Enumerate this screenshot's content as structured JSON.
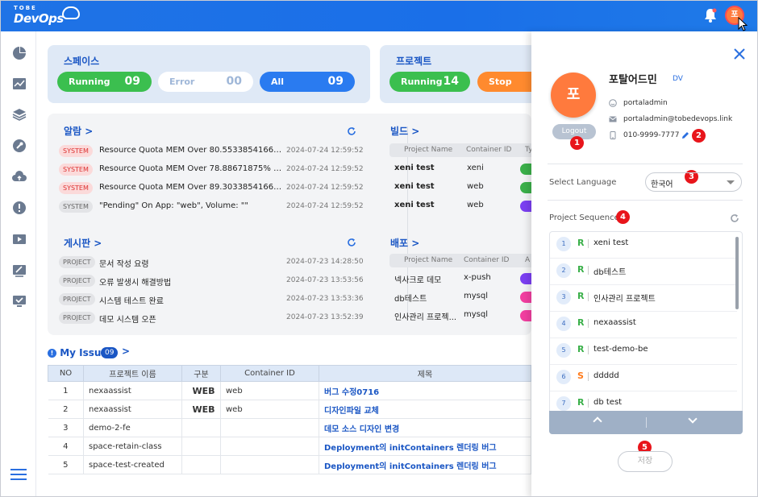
{
  "brand": {
    "tobe": "TOBE",
    "devops": "DevOps"
  },
  "topbar": {
    "avatar_initial": "포"
  },
  "space": {
    "title": "스페이스",
    "running_label": "Running",
    "running_count": "09",
    "error_label": "Error",
    "error_count": "00",
    "all_label": "All",
    "all_count": "09"
  },
  "project": {
    "title": "프로젝트",
    "running_label": "Running",
    "running_count": "14",
    "stop_label": "Stop"
  },
  "alarm": {
    "title": "알람 >",
    "rows": [
      {
        "tag": "SYSTEM",
        "text": "Resource Quota MEM Over 80.5533854166666...",
        "time": "2024-07-24 12:59:52"
      },
      {
        "tag": "SYSTEM",
        "text": "Resource Quota MEM Over 78.88671875% On ...",
        "time": "2024-07-24 12:59:52"
      },
      {
        "tag": "SYSTEM",
        "text": "Resource Quota MEM Over 89.3033854166666...",
        "time": "2024-07-24 12:59:52"
      },
      {
        "tag": "SYSTEM",
        "text": "\"Pending\" On App: \"web\", Volume: \"\"",
        "time": "2024-07-24 12:59:52"
      }
    ]
  },
  "board": {
    "title": "게시판 >",
    "rows": [
      {
        "tag": "PROJECT",
        "text": "문서 작성 요령",
        "time": "2024-07-23 14:28:50"
      },
      {
        "tag": "PROJECT",
        "text": "오류 발생시 해결방법",
        "time": "2024-07-23 13:53:56"
      },
      {
        "tag": "PROJECT",
        "text": "시스템 테스트 완료",
        "time": "2024-07-23 13:53:36"
      },
      {
        "tag": "PROJECT",
        "text": "데모 시스템 오픈",
        "time": "2024-07-23 13:52:39"
      }
    ]
  },
  "build": {
    "title": "빌드 >",
    "col_project": "Project Name",
    "col_container": "Container ID",
    "col_type": "Ty",
    "rows": [
      {
        "project": "xeni test",
        "container": "xeni",
        "color": "#3bb04a"
      },
      {
        "project": "xeni test",
        "container": "web",
        "color": "#3bb04a"
      },
      {
        "project": "xeni test",
        "container": "web",
        "color": "#7b3ff2"
      }
    ]
  },
  "deploy": {
    "title": "배포 >",
    "col_project": "Project Name",
    "col_container": "Container ID",
    "col_type": "A",
    "rows": [
      {
        "project": "넥사크로 데모",
        "container": "x-push",
        "color": "#7b3ff2"
      },
      {
        "project": "db테스트",
        "container": "mysql",
        "color": "#f23fa0"
      },
      {
        "project": "인사관리 프로젝...",
        "container": "mysql",
        "color": "#f23fa0"
      }
    ]
  },
  "my_issue": {
    "title": "My Issue",
    "count": "09",
    "headers": [
      "NO",
      "프로젝트 이름",
      "구분",
      "Container ID",
      "제목"
    ],
    "rows": [
      {
        "no": "1",
        "project": "nexaassist",
        "type": "WEB",
        "container": "web",
        "title": "버그 수정0716"
      },
      {
        "no": "2",
        "project": "nexaassist",
        "type": "WEB",
        "container": "web",
        "title": "디자인파일 교체"
      },
      {
        "no": "3",
        "project": "demo-2-fe",
        "type": "",
        "container": "",
        "title": "데모 소스 디자인 변경"
      },
      {
        "no": "4",
        "project": "space-retain-class",
        "type": "",
        "container": "",
        "title": "Deployment의 initContainers 렌더링 버그"
      },
      {
        "no": "5",
        "project": "space-test-created",
        "type": "",
        "container": "",
        "title": "Deployment의 initContainers 렌더링 버그"
      }
    ]
  },
  "profile": {
    "initial": "포",
    "name": "포탈어드민",
    "role": "DV",
    "username": "portaladmin",
    "email": "portaladmin@tobedevops.link",
    "phone": "010-9999-7777",
    "logout_label": "Logout",
    "language_label": "Select Language",
    "language_value": "한국어",
    "sequence_label": "Project Sequence",
    "save_label": "저장",
    "badges": [
      "1",
      "2",
      "3",
      "4",
      "5"
    ],
    "sequence": [
      {
        "num": "1",
        "type": "R",
        "name": "xeni test"
      },
      {
        "num": "2",
        "type": "R",
        "name": "db테스트"
      },
      {
        "num": "3",
        "type": "R",
        "name": "인사관리 프로젝트"
      },
      {
        "num": "4",
        "type": "R",
        "name": "nexaassist"
      },
      {
        "num": "5",
        "type": "R",
        "name": "test-demo-be"
      },
      {
        "num": "6",
        "type": "S",
        "name": "ddddd"
      },
      {
        "num": "7",
        "type": "R",
        "name": "db test"
      }
    ]
  }
}
